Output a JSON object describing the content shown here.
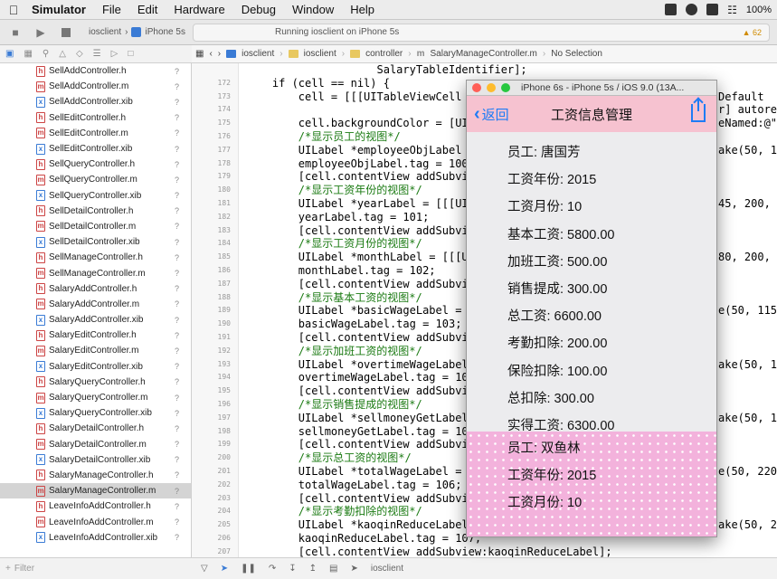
{
  "menubar": {
    "app": "Simulator",
    "items": [
      "File",
      "Edit",
      "Hardware",
      "Debug",
      "Window",
      "Help"
    ],
    "battery": "100%"
  },
  "toolbar": {
    "scheme_target": "iosclient",
    "scheme_device": "iPhone 5s",
    "run_status": "Running iosclient on iPhone 5s",
    "warning_count": "62"
  },
  "jumpbar": {
    "crumbs": [
      "iosclient",
      "iosclient",
      "controller",
      "SalaryManageController.m",
      "No Selection"
    ]
  },
  "files": [
    {
      "name": "SellAddController.h",
      "type": "h"
    },
    {
      "name": "SellAddController.m",
      "type": "m"
    },
    {
      "name": "SellAddController.xib",
      "type": "xib"
    },
    {
      "name": "SellEditController.h",
      "type": "h"
    },
    {
      "name": "SellEditController.m",
      "type": "m"
    },
    {
      "name": "SellEditController.xib",
      "type": "xib"
    },
    {
      "name": "SellQueryController.h",
      "type": "h"
    },
    {
      "name": "SellQueryController.m",
      "type": "m"
    },
    {
      "name": "SellQueryController.xib",
      "type": "xib"
    },
    {
      "name": "SellDetailController.h",
      "type": "h"
    },
    {
      "name": "SellDetailController.m",
      "type": "m"
    },
    {
      "name": "SellDetailController.xib",
      "type": "xib"
    },
    {
      "name": "SellManageController.h",
      "type": "h"
    },
    {
      "name": "SellManageController.m",
      "type": "m"
    },
    {
      "name": "SalaryAddController.h",
      "type": "h"
    },
    {
      "name": "SalaryAddController.m",
      "type": "m"
    },
    {
      "name": "SalaryAddController.xib",
      "type": "xib"
    },
    {
      "name": "SalaryEditController.h",
      "type": "h"
    },
    {
      "name": "SalaryEditController.m",
      "type": "m"
    },
    {
      "name": "SalaryEditController.xib",
      "type": "xib"
    },
    {
      "name": "SalaryQueryController.h",
      "type": "h"
    },
    {
      "name": "SalaryQueryController.m",
      "type": "m"
    },
    {
      "name": "SalaryQueryController.xib",
      "type": "xib"
    },
    {
      "name": "SalaryDetailController.h",
      "type": "h"
    },
    {
      "name": "SalaryDetailController.m",
      "type": "m"
    },
    {
      "name": "SalaryDetailController.xib",
      "type": "xib"
    },
    {
      "name": "SalaryManageController.h",
      "type": "h"
    },
    {
      "name": "SalaryManageController.m",
      "type": "m",
      "selected": true
    },
    {
      "name": "LeaveInfoAddController.h",
      "type": "h"
    },
    {
      "name": "LeaveInfoAddController.m",
      "type": "m"
    },
    {
      "name": "LeaveInfoAddController.xib",
      "type": "xib"
    }
  ],
  "file_status": "?",
  "sidebar_filter": "Filter",
  "line_numbers": [
    "",
    "172",
    "173",
    "174",
    "175",
    "176",
    "177",
    "178",
    "179",
    "180",
    "181",
    "182",
    "183",
    "184",
    "185",
    "186",
    "187",
    "188",
    "189",
    "190",
    "191",
    "192",
    "193",
    "194",
    "195",
    "196",
    "197",
    "198",
    "199",
    "200",
    "201",
    "202",
    "203",
    "204",
    "205",
    "206",
    "207"
  ],
  "code_lines": [
    {
      "t": "                    SalaryTableIdentifier];",
      "c": false
    },
    {
      "t": "    if (cell == nil) {",
      "c": false
    },
    {
      "t": "        cell = [[[UITableViewCell allo",
      "c": false
    },
    {
      "t": "",
      "c": false
    },
    {
      "t": "        cell.backgroundColor = [UIColo",
      "c": false
    },
    {
      "t": "        /*显示员工的视图*/",
      "c": true
    },
    {
      "t": "        UILabel *employeeObjLabel = [[",
      "c": false
    },
    {
      "t": "        employeeObjLabel.tag = 100;",
      "c": false
    },
    {
      "t": "        [cell.contentView addSubview:e",
      "c": false
    },
    {
      "t": "        /*显示工资年份的视图*/",
      "c": true
    },
    {
      "t": "        UILabel *yearLabel = [[[UILabe",
      "c": false
    },
    {
      "t": "        yearLabel.tag = 101;",
      "c": false
    },
    {
      "t": "        [cell.contentView addSubview:y",
      "c": false
    },
    {
      "t": "        /*显示工资月份的视图*/",
      "c": true
    },
    {
      "t": "        UILabel *monthLabel = [[[UILab",
      "c": false
    },
    {
      "t": "        monthLabel.tag = 102;",
      "c": false
    },
    {
      "t": "        [cell.contentView addSubview:m",
      "c": false
    },
    {
      "t": "        /*显示基本工资的视图*/",
      "c": true
    },
    {
      "t": "        UILabel *basicWageLabel = [[[U",
      "c": false
    },
    {
      "t": "        basicWageLabel.tag = 103;",
      "c": false
    },
    {
      "t": "        [cell.contentView addSubview:b",
      "c": false
    },
    {
      "t": "        /*显示加班工资的视图*/",
      "c": true
    },
    {
      "t": "        UILabel *overtimeWageLabel = [",
      "c": false
    },
    {
      "t": "        overtimeWageLabel.tag = 104;",
      "c": false
    },
    {
      "t": "        [cell.contentView addSubview:o",
      "c": false
    },
    {
      "t": "        /*显示销售提成的视图*/",
      "c": true
    },
    {
      "t": "        UILabel *sellmoneyGetLabel = [",
      "c": false
    },
    {
      "t": "        sellmoneyGetLabel.tag = 105;",
      "c": false
    },
    {
      "t": "        [cell.contentView addSubview:s",
      "c": false
    },
    {
      "t": "        /*显示总工资的视图*/",
      "c": true
    },
    {
      "t": "        UILabel *totalWageLabel = [[[U",
      "c": false
    },
    {
      "t": "        totalWageLabel.tag = 106;",
      "c": false
    },
    {
      "t": "        [cell.contentView addSubview:t",
      "c": false
    },
    {
      "t": "        /*显示考勤扣除的视图*/",
      "c": true
    },
    {
      "t": "        UILabel *kaoqinReduceLabel = [",
      "c": false
    },
    {
      "t": "        kaoqinReduceLabel.tag = 107;",
      "c": false
    },
    {
      "t": "        [cell.contentView addSubview:kaoqinReduceLabel];",
      "c": false
    }
  ],
  "code_right": [
    {
      "t": "Default",
      "row": 2
    },
    {
      "t": "r] autore",
      "row": 3
    },
    {
      "t": "eNamed:@\"c",
      "row": 4
    },
    {
      "t": "ake(50, 10",
      "row": 6
    },
    {
      "t": "45, 200,",
      "row": 10
    },
    {
      "t": "80, 200,",
      "row": 14
    },
    {
      "t": "e(50, 115,",
      "row": 18
    },
    {
      "t": "ake(50, 1",
      "row": 22
    },
    {
      "t": "ake(50, 1",
      "row": 26
    },
    {
      "t": "e(50, 220,",
      "row": 30
    },
    {
      "t": "ake(50, 2",
      "row": 34
    }
  ],
  "bottombar": {
    "target": "iosclient"
  },
  "simulator": {
    "window_title": "iPhone 6s - iPhone 5s / iOS 9.0 (13A...",
    "nav": {
      "back": "返回",
      "title": "工资信息管理"
    },
    "record1": [
      "员工: 唐国芳",
      "工资年份: 2015",
      "工资月份: 10",
      "基本工资: 5800.00",
      "加班工资: 500.00",
      "销售提成: 300.00",
      "总工资: 6600.00",
      "考勤扣除: 200.00",
      "保险扣除: 100.00",
      "总扣除: 300.00",
      "实得工资: 6300.00"
    ],
    "record2": [
      "员工: 双鱼林",
      "工资年份: 2015",
      "工资月份: 10"
    ]
  }
}
